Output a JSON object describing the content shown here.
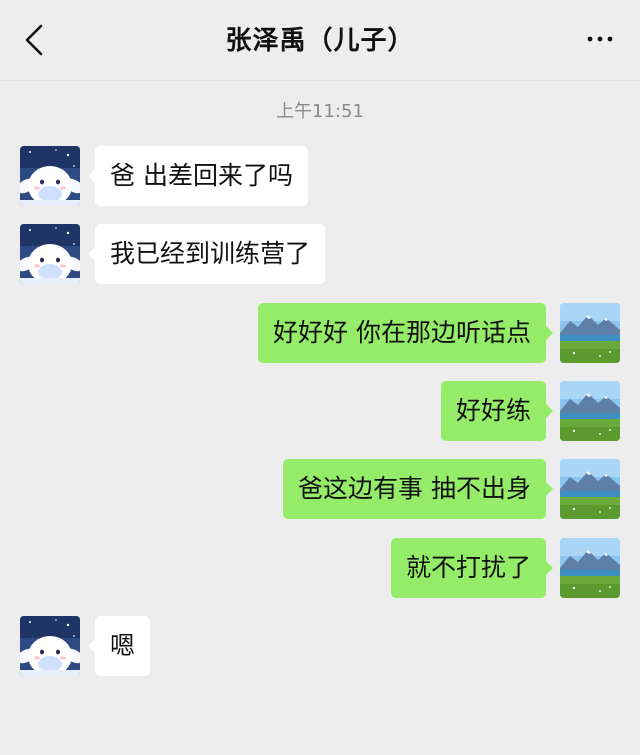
{
  "header": {
    "title": "张泽禹（儿子）",
    "back_icon": "chevron-left-icon",
    "more_icon": "more-dots-icon"
  },
  "chat": {
    "timestamp": "上午11:51",
    "messages": [
      {
        "side": "left",
        "text": "爸 出差回来了吗"
      },
      {
        "side": "left",
        "text": "我已经到训练营了"
      },
      {
        "side": "right",
        "text": "好好好 你在那边听话点"
      },
      {
        "side": "right",
        "text": "好好练"
      },
      {
        "side": "right",
        "text": "爸这边有事 抽不出身"
      },
      {
        "side": "right",
        "text": "就不打扰了"
      },
      {
        "side": "left",
        "text": "嗯"
      }
    ]
  },
  "colors": {
    "background": "#ededed",
    "bubble_self": "#95ec69",
    "bubble_other": "#ffffff",
    "timestamp": "#8a8a8a"
  }
}
